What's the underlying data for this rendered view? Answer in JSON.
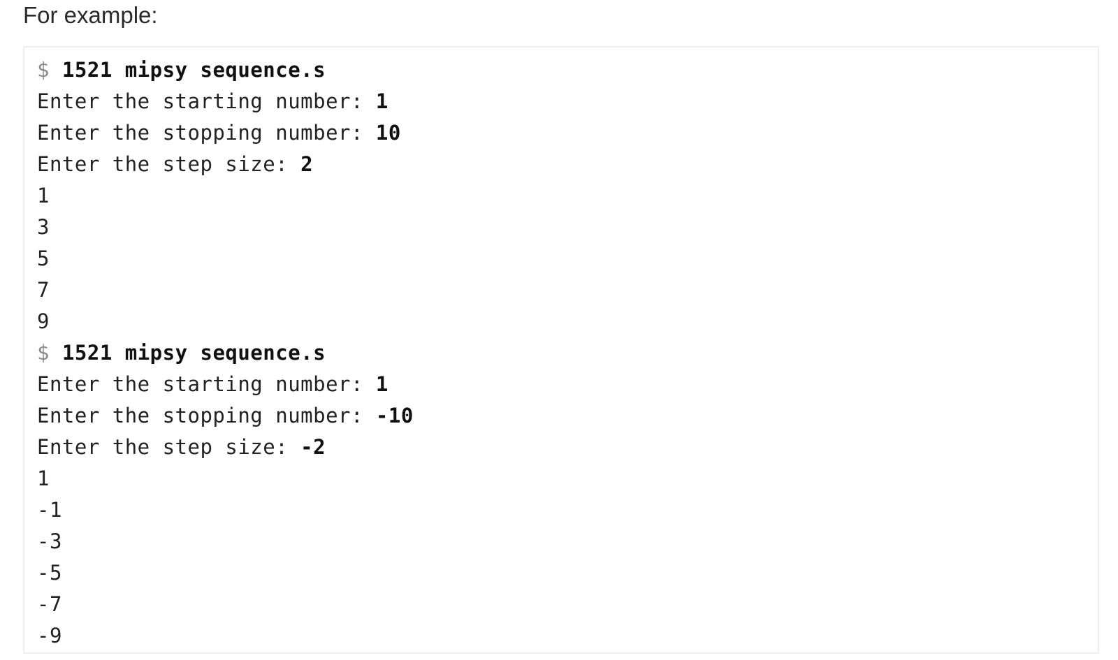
{
  "intro": "For example:",
  "sessions": [
    {
      "prompt": "$",
      "command": "1521 mipsy sequence.s",
      "prompts": [
        {
          "label": "Enter the starting number: ",
          "input": "1"
        },
        {
          "label": "Enter the stopping number: ",
          "input": "10"
        },
        {
          "label": "Enter the step size: ",
          "input": "2"
        }
      ],
      "output": [
        "1",
        "3",
        "5",
        "7",
        "9"
      ]
    },
    {
      "prompt": "$",
      "command": "1521 mipsy sequence.s",
      "prompts": [
        {
          "label": "Enter the starting number: ",
          "input": "1"
        },
        {
          "label": "Enter the stopping number: ",
          "input": "-10"
        },
        {
          "label": "Enter the step size: ",
          "input": "-2"
        }
      ],
      "output": [
        "1",
        "-1",
        "-3",
        "-5",
        "-7",
        "-9"
      ]
    }
  ]
}
